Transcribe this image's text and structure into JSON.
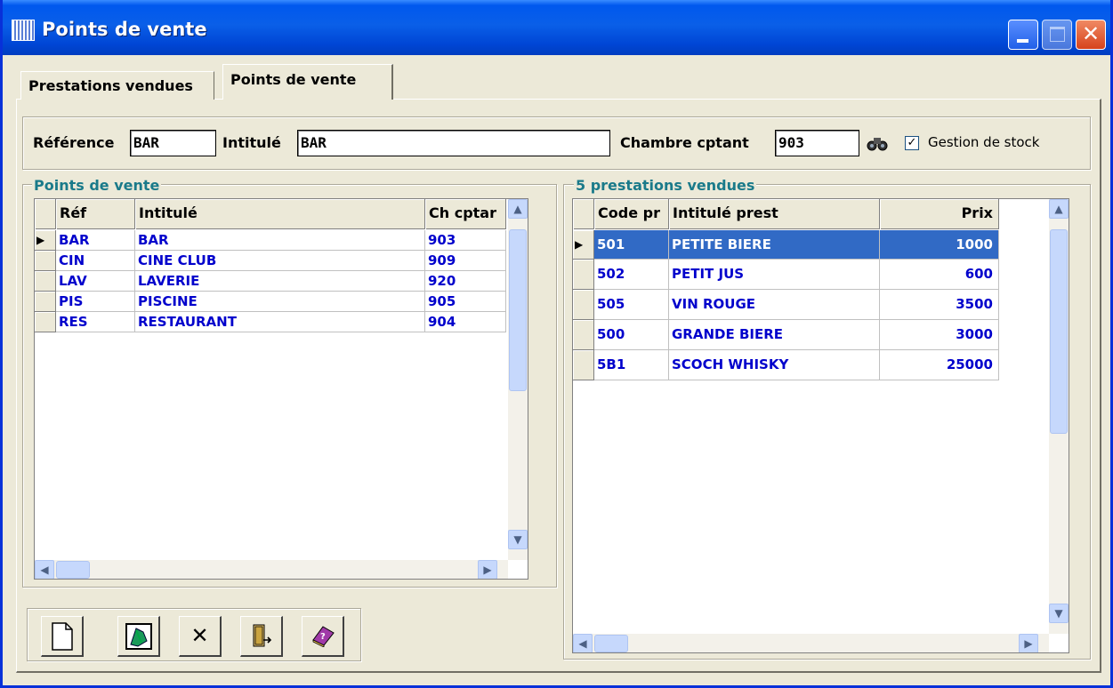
{
  "window": {
    "title": "Points de vente",
    "close_glyph": "✕"
  },
  "tabs": [
    {
      "label": "Prestations vendues"
    },
    {
      "label": "Points de vente"
    }
  ],
  "header": {
    "reference_label": "Référence",
    "reference_value": "BAR",
    "intitule_label": "Intitulé",
    "intitule_value": "BAR",
    "chambre_label": "Chambre cptant",
    "chambre_value": "903",
    "search_icon": "binoculars-icon",
    "stock_checked": "✓",
    "stock_label": "Gestion de stock"
  },
  "points_de_vente": {
    "title": "Points de vente",
    "columns": [
      "Réf",
      "Intitulé",
      "Ch cptar"
    ],
    "rows": [
      {
        "ref": "BAR",
        "intitule": "BAR",
        "ch": "903"
      },
      {
        "ref": "CIN",
        "intitule": "CINE CLUB",
        "ch": "909"
      },
      {
        "ref": "LAV",
        "intitule": "LAVERIE",
        "ch": "920"
      },
      {
        "ref": "PIS",
        "intitule": "PISCINE",
        "ch": "905"
      },
      {
        "ref": "RES",
        "intitule": "RESTAURANT",
        "ch": "904"
      }
    ]
  },
  "prestations": {
    "title": "5 prestations vendues",
    "columns": [
      "Code pr",
      "Intitulé prest",
      "Prix"
    ],
    "rows": [
      {
        "code": "501",
        "intitule": "PETITE BIERE",
        "prix": "1000"
      },
      {
        "code": "502",
        "intitule": "PETIT JUS",
        "prix": "600"
      },
      {
        "code": "505",
        "intitule": "VIN ROUGE",
        "prix": "3500"
      },
      {
        "code": "500",
        "intitule": "GRANDE BIERE",
        "prix": "3000"
      },
      {
        "code": "5B1",
        "intitule": "SCOCH WHISKY",
        "prix": "25000"
      }
    ]
  },
  "scroll_glyphs": {
    "up": "▲",
    "down": "▼",
    "left": "◀",
    "right": "▶",
    "row_pointer": "▶"
  },
  "toolbar": {
    "icons": [
      "new-document-icon",
      "edit-icon",
      "delete-icon",
      "exit-door-icon",
      "help-book-icon"
    ],
    "delete_glyph": "✕"
  }
}
